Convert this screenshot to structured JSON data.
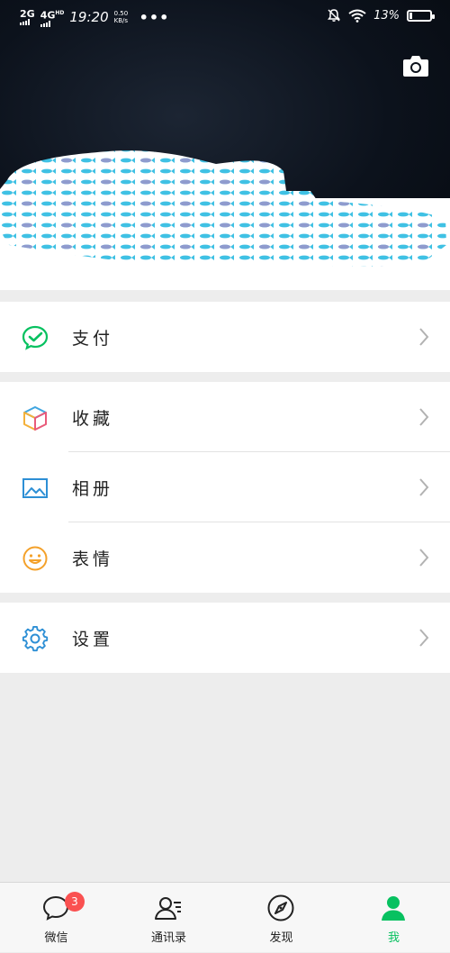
{
  "status_bar": {
    "network_primary": "2G",
    "network_secondary": "4G",
    "network_hd": "HD",
    "time": "19:20",
    "speed_value": "0.50",
    "speed_unit": "KB/s",
    "more": "•••",
    "battery_percent": "13%",
    "battery_level": 0.13
  },
  "header": {
    "camera_icon": "camera-icon"
  },
  "menu": {
    "pay": {
      "label": "支付",
      "icon": "wechat-pay-icon"
    },
    "favorites": {
      "label": "收藏",
      "icon": "cube-icon"
    },
    "album": {
      "label": "相册",
      "icon": "picture-icon"
    },
    "stickers": {
      "label": "表情",
      "icon": "smiley-icon"
    },
    "settings": {
      "label": "设置",
      "icon": "gear-icon"
    }
  },
  "tabs": [
    {
      "label": "微信",
      "icon": "chat-bubble-icon",
      "badge": "3"
    },
    {
      "label": "通讯录",
      "icon": "contacts-icon"
    },
    {
      "label": "发现",
      "icon": "compass-icon"
    },
    {
      "label": "我",
      "icon": "person-icon",
      "active": true
    }
  ],
  "colors": {
    "accent": "#07c160",
    "badge": "#fa5151",
    "header_bg": "#0c121c"
  }
}
